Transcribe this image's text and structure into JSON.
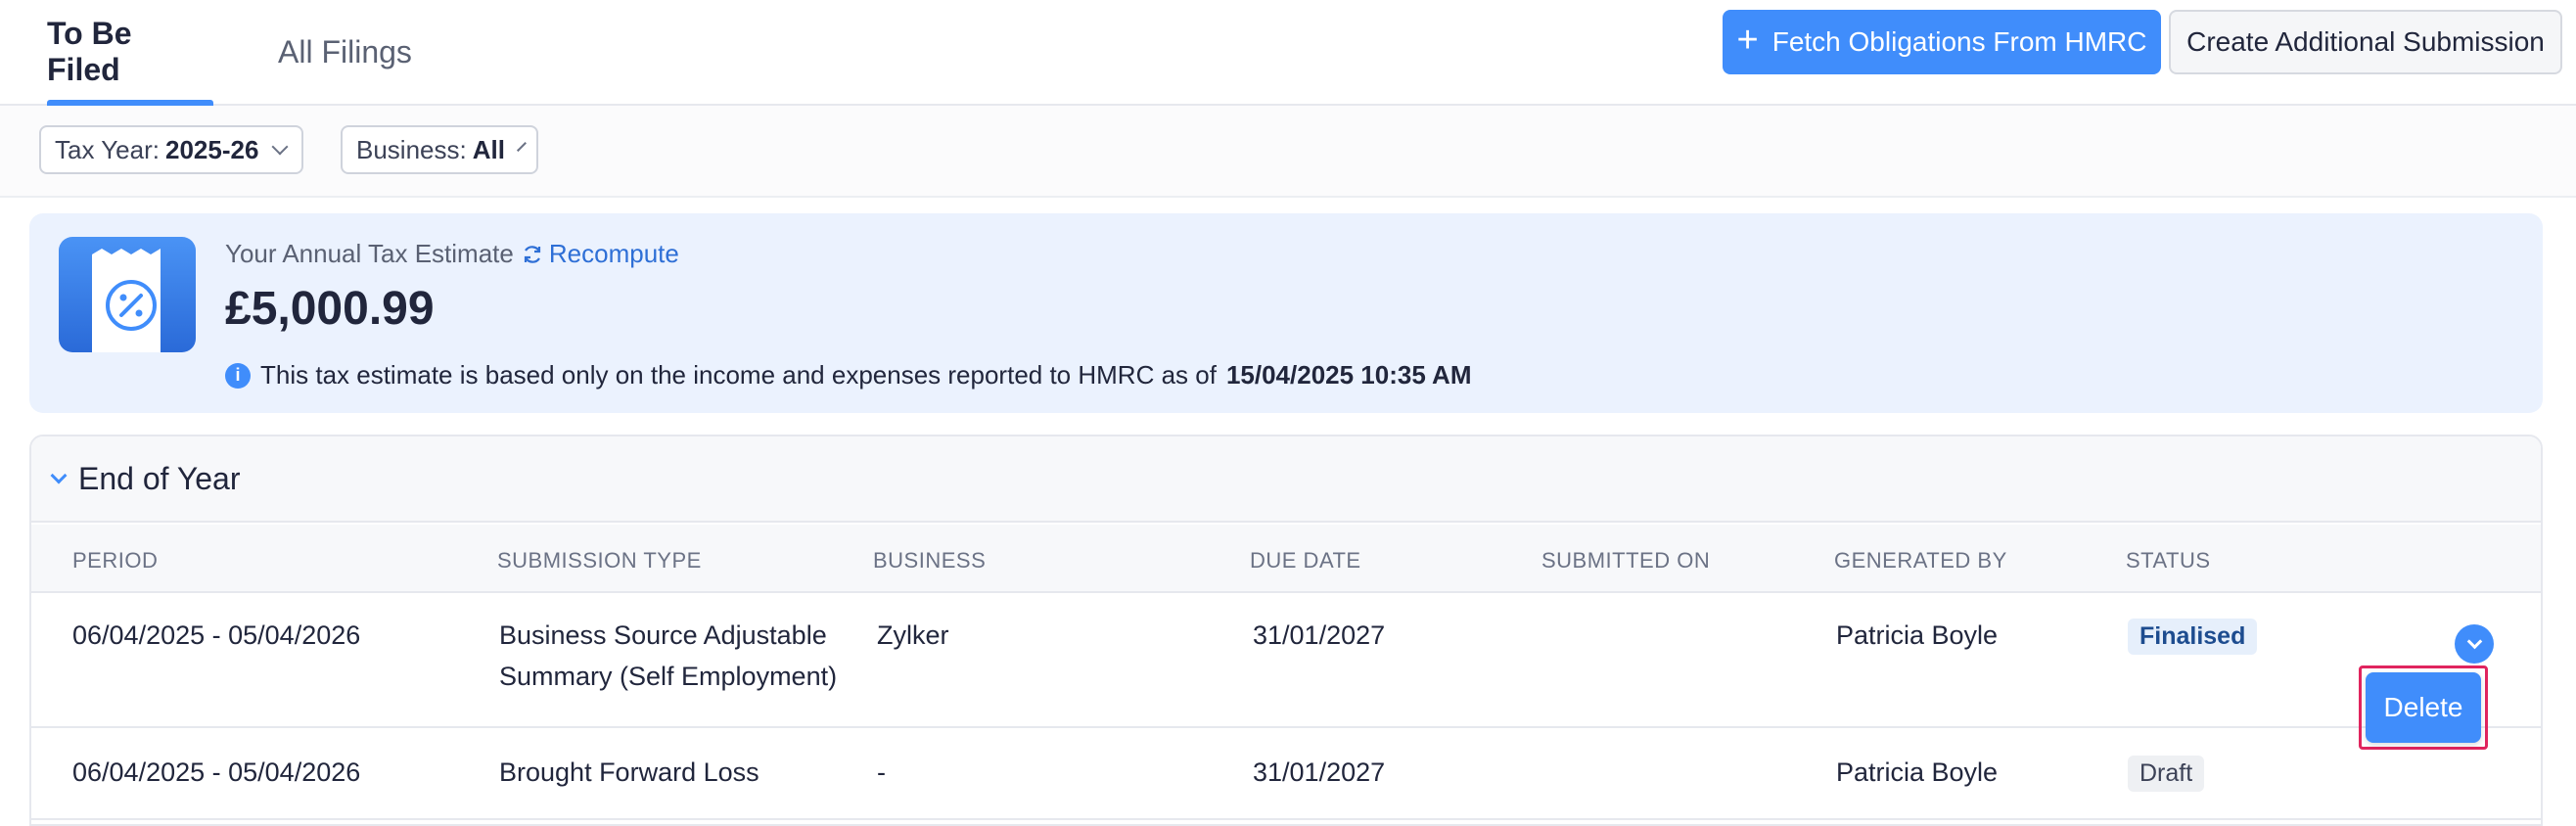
{
  "tabs": [
    {
      "label": "To Be Filed",
      "active": true
    },
    {
      "label": "All Filings",
      "active": false
    }
  ],
  "toolbar": {
    "fetch_label": "Fetch Obligations From HMRC",
    "create_label": "Create Additional Submission"
  },
  "filters": {
    "tax_year_label": "Tax Year:",
    "tax_year_value": "2025-26",
    "business_label": "Business:",
    "business_value": "All"
  },
  "estimate": {
    "title": "Your Annual Tax Estimate",
    "recompute_label": "Recompute",
    "amount": "£5,000.99",
    "note_prefix": "This tax estimate is based only on the income and expenses reported to HMRC as of",
    "note_datetime": "15/04/2025 10:35 AM"
  },
  "section": {
    "title": "End of Year",
    "columns": [
      "PERIOD",
      "SUBMISSION TYPE",
      "BUSINESS",
      "DUE DATE",
      "SUBMITTED ON",
      "GENERATED BY",
      "STATUS"
    ],
    "rows": [
      {
        "period": "06/04/2025 - 05/04/2026",
        "submission_type_line1": "Business Source Adjustable",
        "submission_type_line2": "Summary (Self Employment)",
        "business": "Zylker",
        "due_date": "31/01/2027",
        "submitted_on": "",
        "generated_by": "Patricia Boyle",
        "status": "Finalised"
      },
      {
        "period": "06/04/2025 - 05/04/2026",
        "submission_type_line1": "Brought Forward Loss",
        "submission_type_line2": "",
        "business": "-",
        "due_date": "31/01/2027",
        "submitted_on": "",
        "generated_by": "Patricia Boyle",
        "status": "Draft"
      }
    ]
  },
  "row_actions": {
    "delete_label": "Delete"
  },
  "colors": {
    "accent": "#408dfb",
    "highlight_border": "#e0245e"
  }
}
